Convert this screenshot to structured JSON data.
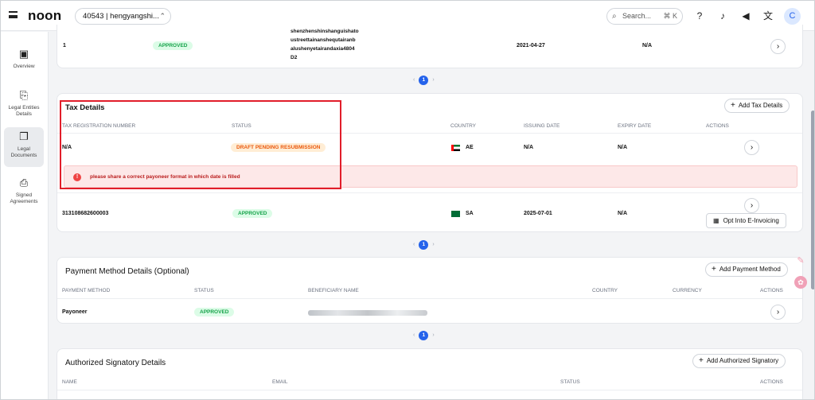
{
  "header": {
    "logo": "noon",
    "store_selector": "40543 | hengyangshi...",
    "search_placeholder": "Search...",
    "search_shortcut": "⌘ K",
    "avatar_initial": "C"
  },
  "sidebar": {
    "items": [
      {
        "label": "Overview",
        "icon": "clipboard-icon",
        "active": false
      },
      {
        "label": "Legal Entities Details",
        "icon": "document-icon",
        "active": false
      },
      {
        "label": "Legal Documents",
        "icon": "documents-icon",
        "active": true
      },
      {
        "label": "Signed Agreements",
        "icon": "signed-doc-icon",
        "active": false
      }
    ]
  },
  "prev_card": {
    "row": {
      "number": "1",
      "status": "APPROVED",
      "address_lines": [
        "shenzhenshinshanguishato",
        "ustreettainanshequtairanb",
        "alushenyetairandaxia4804",
        "D2"
      ],
      "issuing_date": "2021-04-27",
      "expiry_date": "N/A"
    },
    "page": "1"
  },
  "tax_details": {
    "title": "Tax Details",
    "add_button": "Add Tax Details",
    "columns": [
      "TAX REGISTRATION NUMBER",
      "STATUS",
      "COUNTRY",
      "ISSUING DATE",
      "EXPIRY DATE",
      "ACTIONS"
    ],
    "rows": [
      {
        "number": "N/A",
        "status": "DRAFT PENDING RESUBMISSION",
        "country": "AE",
        "issuing_date": "N/A",
        "expiry_date": "N/A"
      },
      {
        "number": "313108682600003",
        "status": "APPROVED",
        "country": "SA",
        "issuing_date": "2025-07-01",
        "expiry_date": "N/A"
      }
    ],
    "error_message": "please share a correct payoneer format in which date is filled",
    "opt_button": "Opt Into E-Invoicing",
    "page": "1"
  },
  "payment_details": {
    "title": "Payment Method Details (Optional)",
    "add_button": "Add Payment Method",
    "columns": [
      "PAYMENT METHOD",
      "STATUS",
      "BENEFICIARY NAME",
      "COUNTRY",
      "CURRENCY",
      "ACTIONS"
    ],
    "rows": [
      {
        "method": "Payoneer",
        "status": "APPROVED"
      }
    ],
    "page": "1"
  },
  "signatory_details": {
    "title": "Authorized Signatory Details",
    "add_button": "Add Authorized Signatory",
    "columns": [
      "NAME",
      "EMAIL",
      "STATUS",
      "ACTIONS"
    ]
  },
  "colors": {
    "accent": "#2563eb",
    "approved": "#16a34a",
    "draft": "#ea580c",
    "error": "#e11d2a"
  }
}
